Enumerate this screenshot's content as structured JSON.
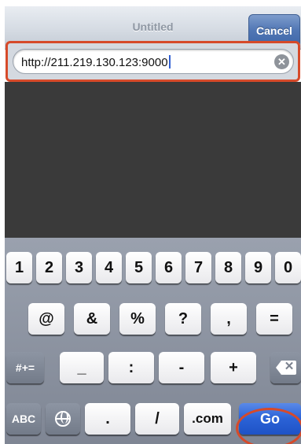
{
  "header": {
    "title": "Untitled",
    "cancel_label": "Cancel"
  },
  "url_bar": {
    "value": "http://211.219.130.123:9000",
    "clear_icon": "clear-icon"
  },
  "keyboard": {
    "row1": [
      "1",
      "2",
      "3",
      "4",
      "5",
      "6",
      "7",
      "8",
      "9",
      "0"
    ],
    "row2": [
      "@",
      "&",
      "%",
      "?",
      ",",
      "="
    ],
    "row3": {
      "mode_label": "#+=",
      "keys": [
        "_",
        ":",
        "-",
        "+"
      ],
      "delete_icon": "backspace-icon"
    },
    "row4": {
      "abc_label": "ABC",
      "globe_icon": "globe-icon",
      "dot": ".",
      "slash": "/",
      "com": ".com",
      "go": "Go"
    }
  },
  "colors": {
    "highlight": "#d64a2a",
    "go_button": "#2b62d6",
    "cancel_button": "#5076b4",
    "content_bg": "#3a3a3a"
  }
}
